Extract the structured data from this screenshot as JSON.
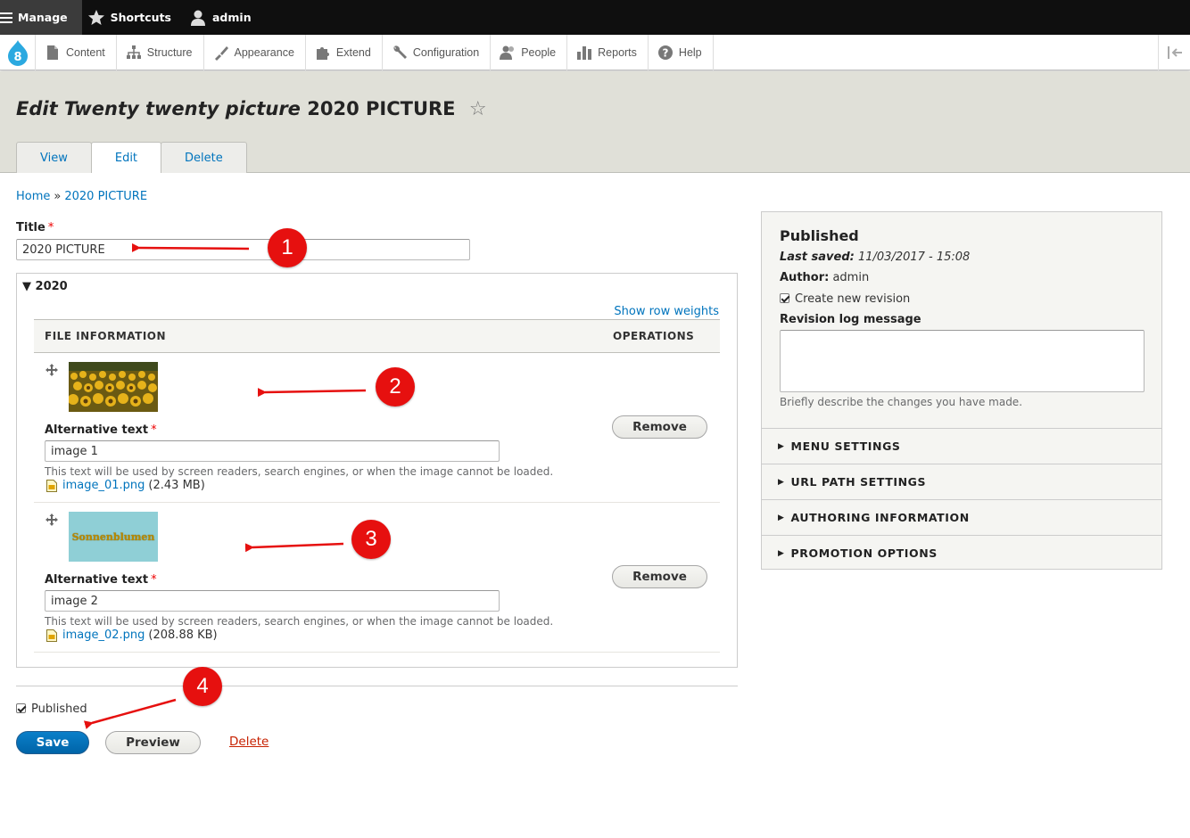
{
  "toolbar": {
    "manage": "Manage",
    "shortcuts": "Shortcuts",
    "user": "admin"
  },
  "tray": {
    "items": [
      {
        "label": "Content",
        "icon": "file-icon"
      },
      {
        "label": "Structure",
        "icon": "sitemap-icon"
      },
      {
        "label": "Appearance",
        "icon": "brush-icon"
      },
      {
        "label": "Extend",
        "icon": "puzzle-icon"
      },
      {
        "label": "Configuration",
        "icon": "wrench-icon"
      },
      {
        "label": "People",
        "icon": "people-icon"
      },
      {
        "label": "Reports",
        "icon": "bar-chart-icon"
      },
      {
        "label": "Help",
        "icon": "help-icon"
      }
    ]
  },
  "header": {
    "title_italic": "Edit Twenty twenty picture",
    "title_node": "2020 PICTURE",
    "tabs": [
      "View",
      "Edit",
      "Delete"
    ],
    "active_tab": "Edit"
  },
  "breadcrumb": {
    "home": "Home",
    "separator": "»",
    "current": "2020 PICTURE"
  },
  "form": {
    "title_label": "Title",
    "title_value": "2020 PICTURE",
    "fieldset_label": "2020",
    "show_row_weights": "Show row weights",
    "col_file_info": "FILE INFORMATION",
    "col_operations": "OPERATIONS",
    "files": [
      {
        "alt_label": "Alternative text",
        "alt_value": "image 1",
        "description": "This text will be used by screen readers, search engines, or when the image cannot be loaded.",
        "filename": "image_01.png",
        "size": "(2.43 MB)",
        "remove_label": "Remove"
      },
      {
        "alt_label": "Alternative text",
        "alt_value": "image 2",
        "description": "This text will be used by screen readers, search engines, or when the image cannot be loaded.",
        "filename": "image_02.png",
        "size": "(208.88 KB)",
        "remove_label": "Remove",
        "thumb_text": "Sonnenblumen"
      }
    ],
    "published_label": "Published",
    "save_label": "Save",
    "preview_label": "Preview",
    "delete_label": "Delete"
  },
  "sidebar": {
    "status": "Published",
    "last_saved_label": "Last saved:",
    "last_saved_value": "11/03/2017 - 15:08",
    "author_label": "Author:",
    "author_value": "admin",
    "new_revision_label": "Create new revision",
    "revision_log_label": "Revision log message",
    "revision_log_desc": "Briefly describe the changes you have made.",
    "sections": [
      "MENU SETTINGS",
      "URL PATH SETTINGS",
      "AUTHORING INFORMATION",
      "PROMOTION OPTIONS"
    ]
  },
  "annotations": {
    "badges": [
      "1",
      "2",
      "3",
      "4"
    ],
    "color": "#e6100f"
  },
  "colors": {
    "link": "#0074bd",
    "save_button": "#0071b8",
    "delete_link": "#c72100",
    "header_bg": "#e0e0d8"
  }
}
